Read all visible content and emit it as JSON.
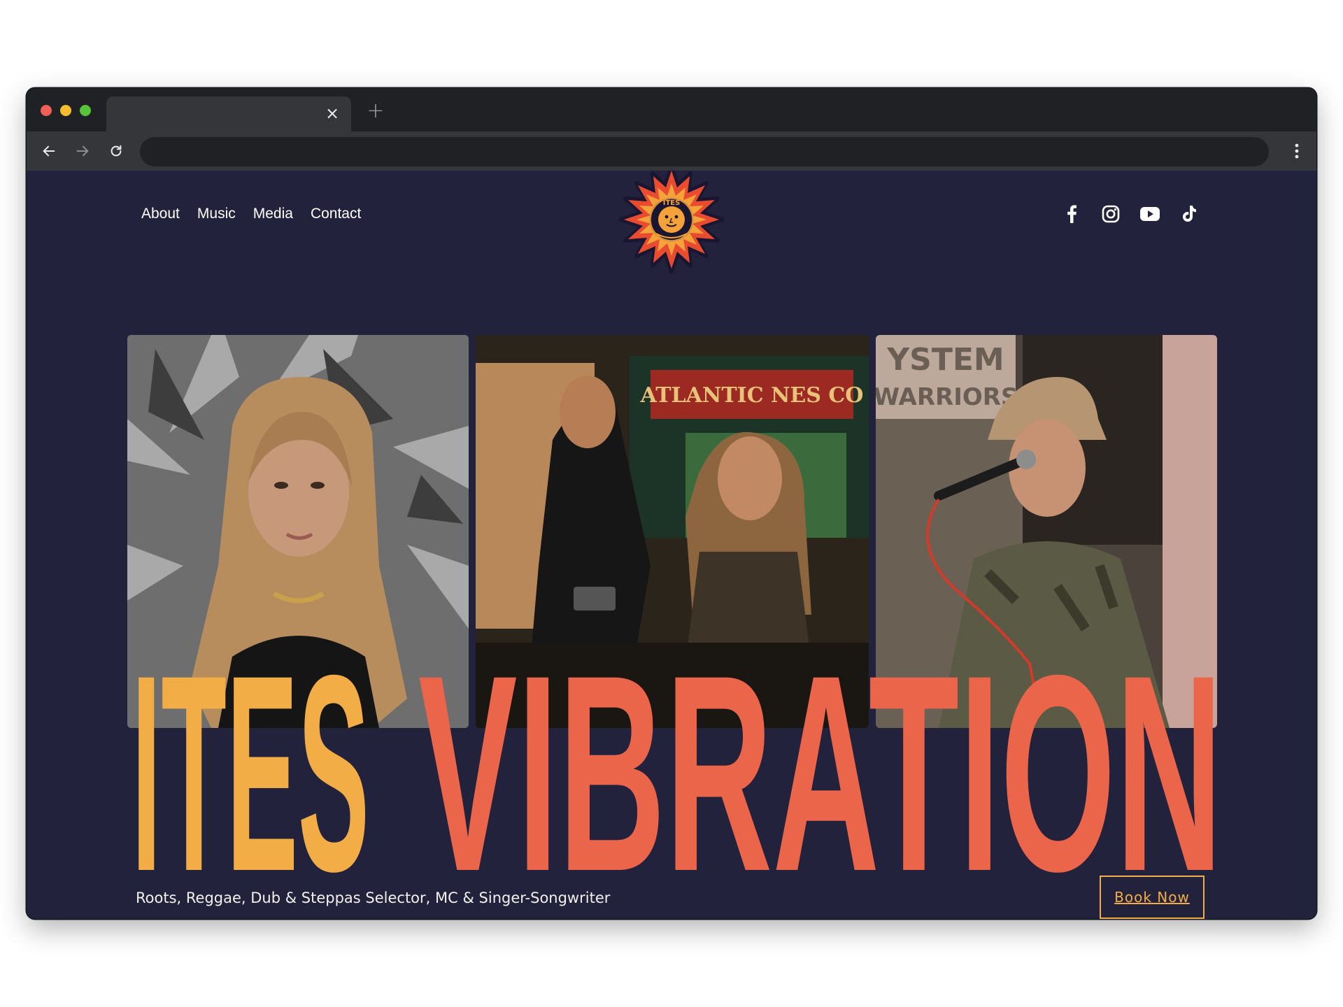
{
  "browser": {
    "tab_title": "",
    "tab_close_glyph": "×",
    "new_tab_glyph": "+",
    "address": ""
  },
  "site": {
    "nav": [
      {
        "label": "About"
      },
      {
        "label": "Music"
      },
      {
        "label": "Media"
      },
      {
        "label": "Contact"
      }
    ],
    "logo": {
      "name": "sun-logo",
      "text": "ITES VIBRATION"
    },
    "socials": [
      "facebook-icon",
      "instagram-icon",
      "youtube-icon",
      "tiktok-icon"
    ],
    "hero": {
      "title_word_1": "ITES",
      "title_word_2": "VIBRATION",
      "tagline": "Roots, Reggae, Dub & Steppas Selector, MC & Singer-Songwriter",
      "cta_label": "Book Now"
    },
    "photos": [
      {
        "name": "portrait-photo"
      },
      {
        "name": "dj-set-photo",
        "visible_sign_text": "ATLANTIC ...NES CO"
      },
      {
        "name": "mc-performance-photo",
        "visible_sign_text": "SYSTEM ... WARRIORS"
      }
    ],
    "colors": {
      "background": "#23223d",
      "accent_yellow": "#f2ad47",
      "accent_orange": "#ea6549",
      "text": "#ffffff"
    }
  }
}
